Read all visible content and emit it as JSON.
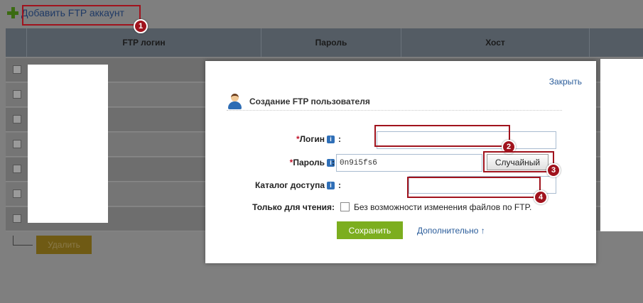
{
  "toolbar": {
    "add_label": "Добавить FTP аккаунт"
  },
  "table": {
    "headers": [
      "FTP логин",
      "Пароль",
      "Хост"
    ],
    "row_count": 7,
    "delete_label": "Удалить"
  },
  "modal": {
    "close_label": "Закрыть",
    "title": "Создание FTP пользователя",
    "login_label": "Логин",
    "password_label": "Пароль",
    "password_value": "0n9i5fs6",
    "random_label": "Случайный",
    "catalog_label": "Каталог доступа",
    "readonly_label": "Только для чтения:",
    "readonly_caption": "Без возможности изменения файлов по FTP.",
    "save_label": "Сохранить",
    "more_label": "Дополнительно ↑",
    "required_mark": "*",
    "info_mark": "i",
    "colon": ":"
  },
  "annotations": [
    "1",
    "2",
    "3",
    "4"
  ],
  "colors": {
    "accent_red": "#a0131d",
    "save_green": "#7cae1f",
    "link_blue": "#2a5c9a"
  }
}
